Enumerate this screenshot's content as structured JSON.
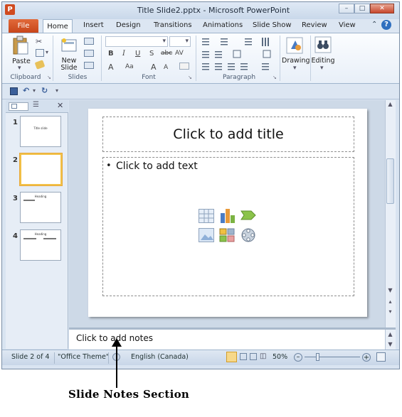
{
  "window": {
    "title": "Title Slide2.pptx - Microsoft PowerPoint",
    "app_icon": "P",
    "buttons": {
      "minimize": "–",
      "maximize": "□",
      "close": "✕"
    }
  },
  "ribbon": {
    "tabs": [
      "File",
      "Home",
      "Insert",
      "Design",
      "Transitions",
      "Animations",
      "Slide Show",
      "Review",
      "View"
    ],
    "active_tab": "Home",
    "groups": {
      "clipboard": {
        "label": "Clipboard",
        "paste_label": "Paste"
      },
      "slides": {
        "label": "Slides",
        "new_slide_label": "New",
        "new_slide_label2": "Slide"
      },
      "font": {
        "label": "Font"
      },
      "paragraph": {
        "label": "Paragraph"
      },
      "drawing": {
        "label": "Drawing"
      },
      "editing": {
        "label": "Editing"
      }
    }
  },
  "slide_panel": {
    "thumbnails": [
      {
        "number": "1",
        "text": "Title slide"
      },
      {
        "number": "2",
        "text": ""
      },
      {
        "number": "3",
        "text": "Heading"
      },
      {
        "number": "4",
        "text": "Heading"
      }
    ],
    "selected": 2
  },
  "slide": {
    "title_placeholder": "Click to add title",
    "body_placeholder": "Click to add text",
    "bullet": "•"
  },
  "notes": {
    "placeholder": "Click to add notes"
  },
  "statusbar": {
    "slide_info": "Slide 2 of 4",
    "theme": "\"Office Theme\"",
    "language": "English (Canada)",
    "zoom": "50%"
  },
  "annotation": {
    "caption": "Slide Notes Section"
  },
  "colors": {
    "file_tab": "#c8451a",
    "accent_selection": "#f2c148"
  }
}
